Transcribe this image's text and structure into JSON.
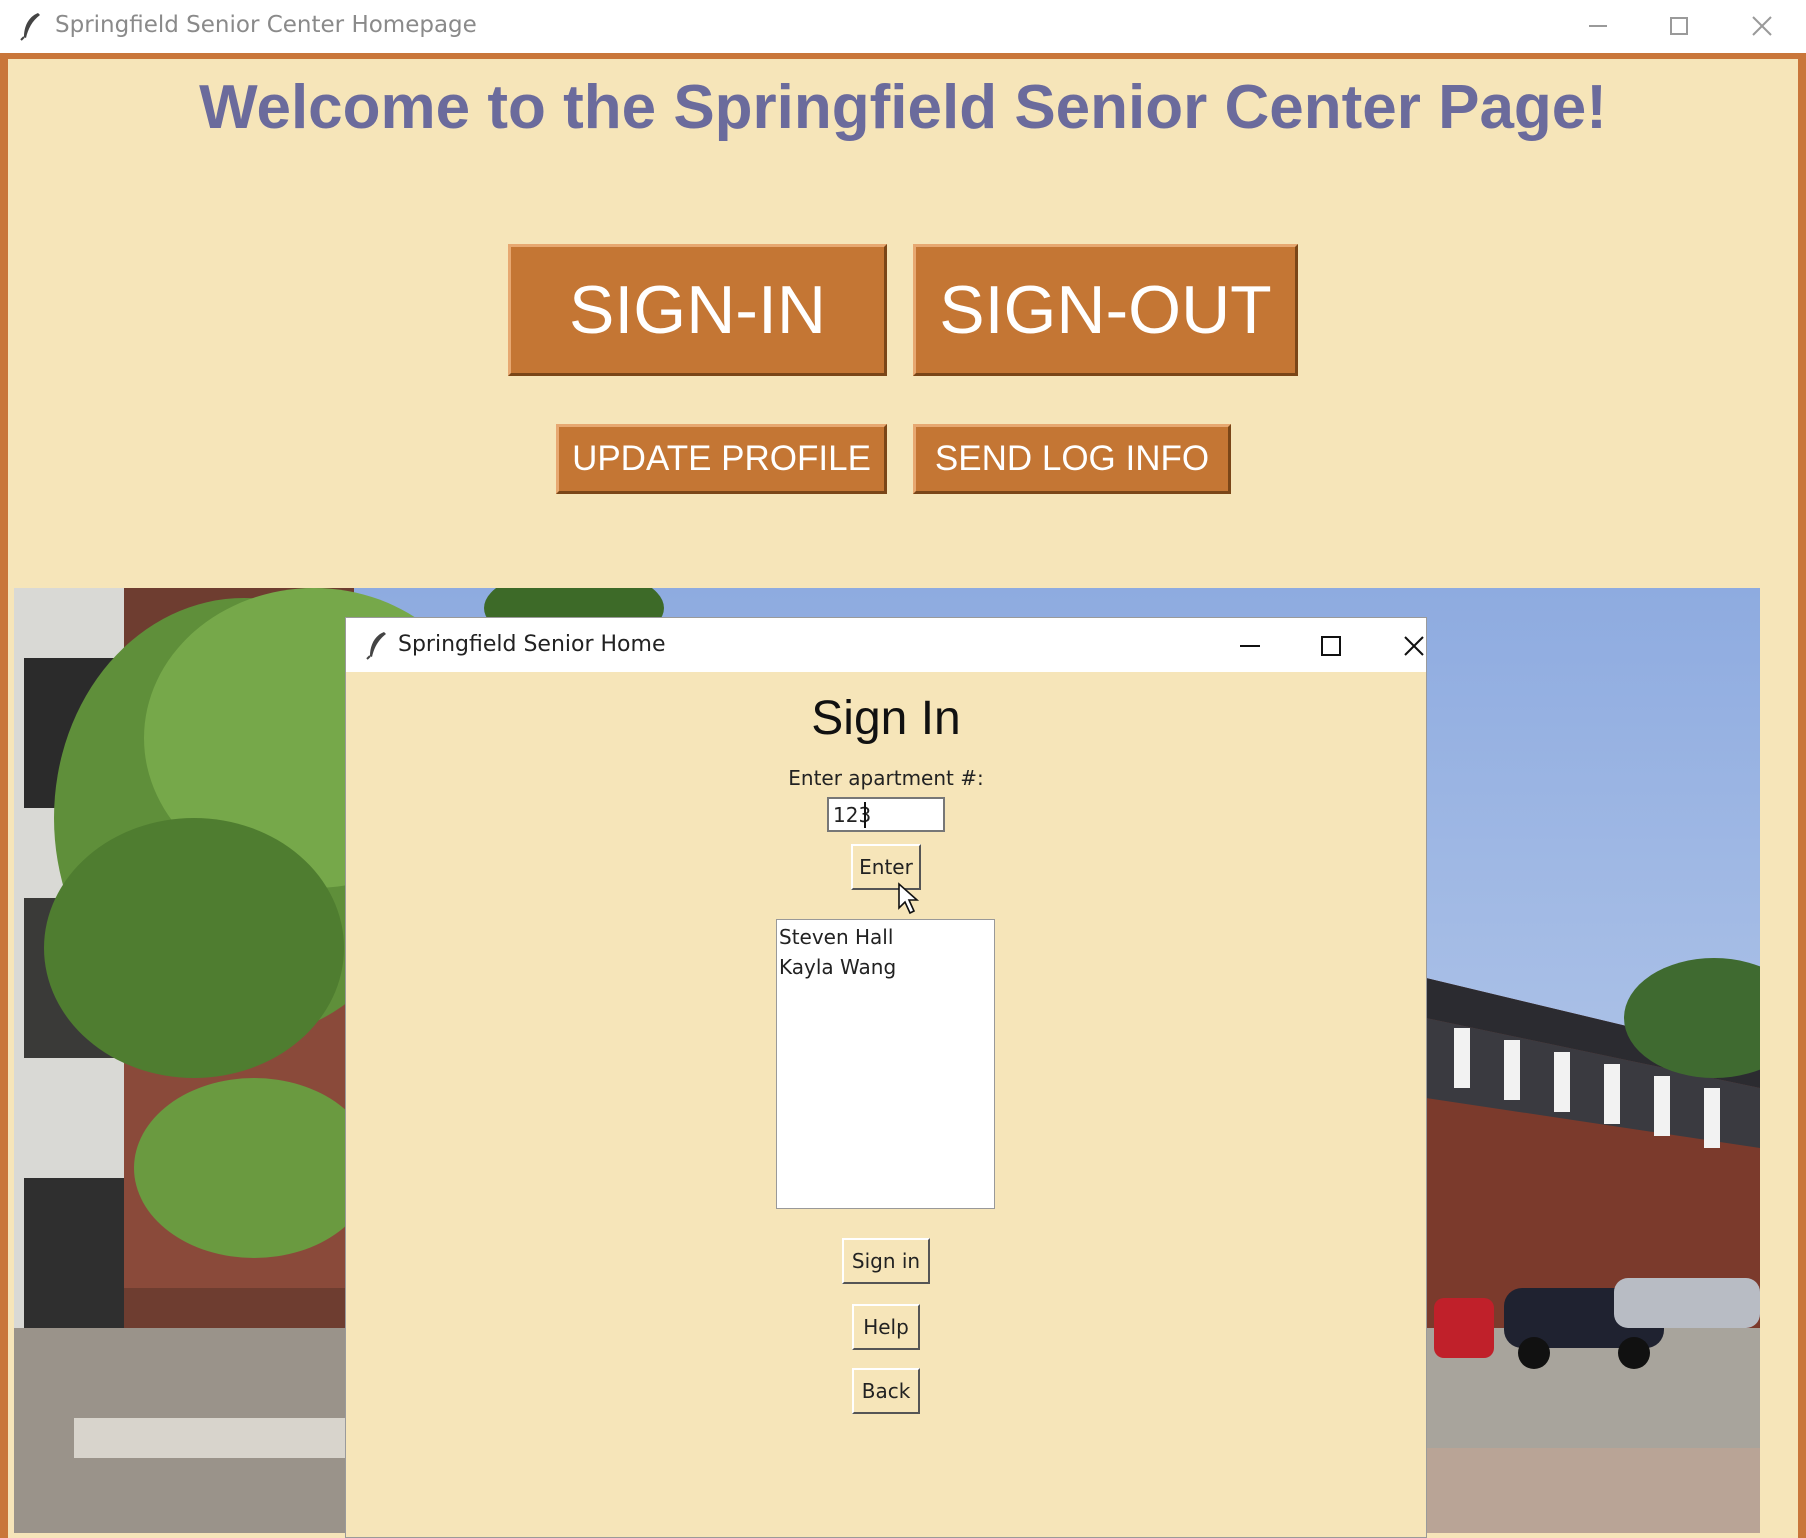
{
  "main_window": {
    "title": "Springfield Senior Center Homepage",
    "welcome": "Welcome to the Springfield Senior Center Page!",
    "buttons": {
      "sign_in": "SIGN-IN",
      "sign_out": "SIGN-OUT",
      "update_profile": "UPDATE PROFILE",
      "send_log_info": "SEND LOG INFO"
    }
  },
  "dialog": {
    "title": "Springfield Senior Home",
    "heading": "Sign In",
    "apartment_label": "Enter apartment #:",
    "apartment_value": "123",
    "enter_label": "Enter",
    "residents": [
      "Steven Hall",
      "Kayla Wang"
    ],
    "sign_in_label": "Sign in",
    "help_label": "Help",
    "back_label": "Back"
  },
  "colors": {
    "background": "#f6e5b9",
    "button": "#c47634",
    "heading": "#6b6b9c"
  },
  "icons": [
    "feather-icon",
    "minimize-icon",
    "maximize-icon",
    "close-icon",
    "mouse-cursor-icon"
  ]
}
